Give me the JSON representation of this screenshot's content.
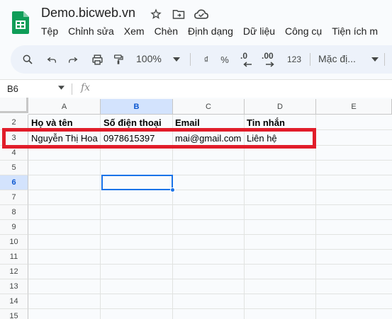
{
  "document": {
    "title": "Demo.bicweb.vn"
  },
  "menu": [
    "Tệp",
    "Chỉnh sửa",
    "Xem",
    "Chèn",
    "Định dạng",
    "Dữ liệu",
    "Công cụ",
    "Tiện ích m"
  ],
  "toolbar": {
    "zoom": "100%",
    "currency": "₫",
    "percent": "%",
    "decrease_decimal": ".0",
    "increase_decimal": ".00",
    "number_format": "123",
    "font": "Mặc đị..."
  },
  "formula_bar": {
    "cell_ref": "B6",
    "fx": "fx"
  },
  "columns": [
    "A",
    "B",
    "C",
    "D",
    "E"
  ],
  "rows": [
    "2",
    "3",
    "4",
    "5",
    "6",
    "7",
    "8",
    "9",
    "10",
    "11",
    "12",
    "13",
    "14",
    "15"
  ],
  "header_row": [
    "Họ và tên",
    "Số điện thoại",
    "Email",
    "Tin nhắn"
  ],
  "data_row": [
    "Nguyễn Thị Hoa",
    "0978615397",
    "mai@gmail.com",
    "Liên hệ"
  ],
  "colors": {
    "accent": "#1a73e8",
    "highlight": "#e11d2a",
    "logo": "#0f9d58"
  }
}
